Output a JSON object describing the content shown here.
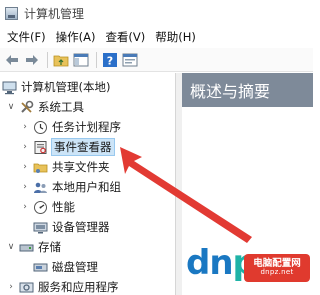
{
  "window": {
    "title": "计算机管理"
  },
  "menu": {
    "items": [
      "文件(F)",
      "操作(A)",
      "查看(V)",
      "帮助(H)"
    ]
  },
  "toolbar": {
    "buttons": [
      "back-arrow-icon",
      "forward-arrow-icon",
      "folder-up-icon",
      "show-hide-tree-icon",
      "help-icon",
      "properties-icon"
    ]
  },
  "tree": {
    "root": "计算机管理(本地)",
    "system_tools": "系统工具",
    "task_scheduler": "任务计划程序",
    "event_viewer": "事件查看器",
    "shared_folders": "共享文件夹",
    "local_users": "本地用户和组",
    "performance": "性能",
    "device_manager": "设备管理器",
    "storage": "存储",
    "disk_management": "磁盘管理",
    "services_apps": "服务和应用程序"
  },
  "right_pane": {
    "header": "概述与摘要"
  },
  "watermark": {
    "text_dn": "dn",
    "text_mid": "pz",
    "text_dot": ".",
    "badge_line1": "电脑配置网",
    "badge_line2": "dnpz.net"
  },
  "colors": {
    "annotation_arrow": "#e23a33",
    "pane_header": "#7e8a99",
    "selection": "#cce4f7"
  }
}
